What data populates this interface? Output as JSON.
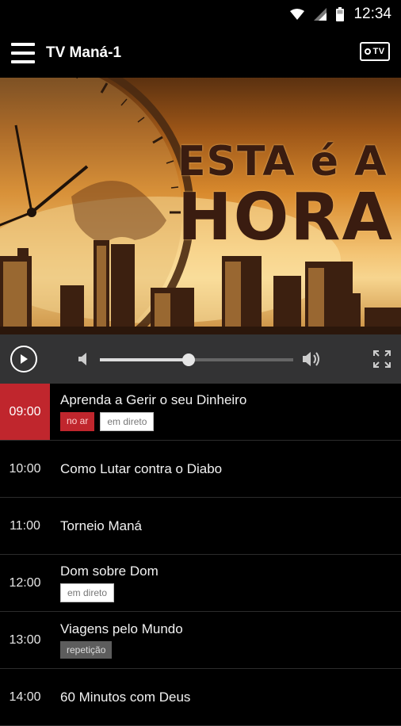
{
  "status_bar": {
    "time": "12:34"
  },
  "app_bar": {
    "title": "TV Maná-1",
    "logo_text": "TV"
  },
  "banner": {
    "line1": "ESTA é A",
    "line2": "HORA"
  },
  "player": {
    "volume_level": 0.46
  },
  "schedule": [
    {
      "time": "09:00",
      "title": "Aprenda a Gerir o seu Dinheiro",
      "tags": [
        "no ar",
        "em direto"
      ]
    },
    {
      "time": "10:00",
      "title": "Como Lutar contra o Diabo",
      "tags": []
    },
    {
      "time": "11:00",
      "title": "Torneio Maná",
      "tags": []
    },
    {
      "time": "12:00",
      "title": "Dom sobre Dom",
      "tags": [
        "em direto"
      ]
    },
    {
      "time": "13:00",
      "title": "Viagens pelo Mundo",
      "tags": [
        "repetição"
      ]
    },
    {
      "time": "14:00",
      "title": "60 Minutos com Deus",
      "tags": []
    }
  ],
  "colors": {
    "accent": "#c0262d",
    "player_bg": "#333334"
  }
}
